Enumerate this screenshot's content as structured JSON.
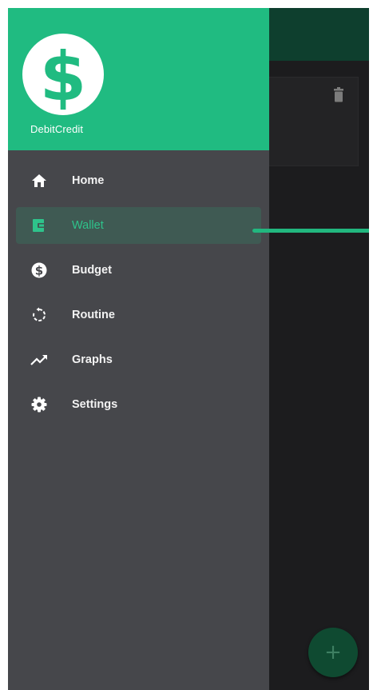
{
  "app": {
    "name": "DebitCredit",
    "logo_icon": "dollar-icon"
  },
  "colors": {
    "header": "#20bb81",
    "accent": "#2ec38b",
    "drawer_bg": "#46474b",
    "app_bg": "#1c1c1e",
    "appbar_bg": "#0e3f2e"
  },
  "menu": {
    "items": [
      {
        "label": "Home",
        "icon": "home-icon",
        "active": false
      },
      {
        "label": "Wallet",
        "icon": "wallet-icon",
        "active": true
      },
      {
        "label": "Budget",
        "icon": "dollar-circle-icon",
        "active": false
      },
      {
        "label": "Routine",
        "icon": "restore-icon",
        "active": false
      },
      {
        "label": "Graphs",
        "icon": "trending-up-icon",
        "active": false
      },
      {
        "label": "Settings",
        "icon": "gear-icon",
        "active": false
      }
    ]
  },
  "background": {
    "card_action_icon": "trash-icon",
    "fab_label": "+"
  }
}
